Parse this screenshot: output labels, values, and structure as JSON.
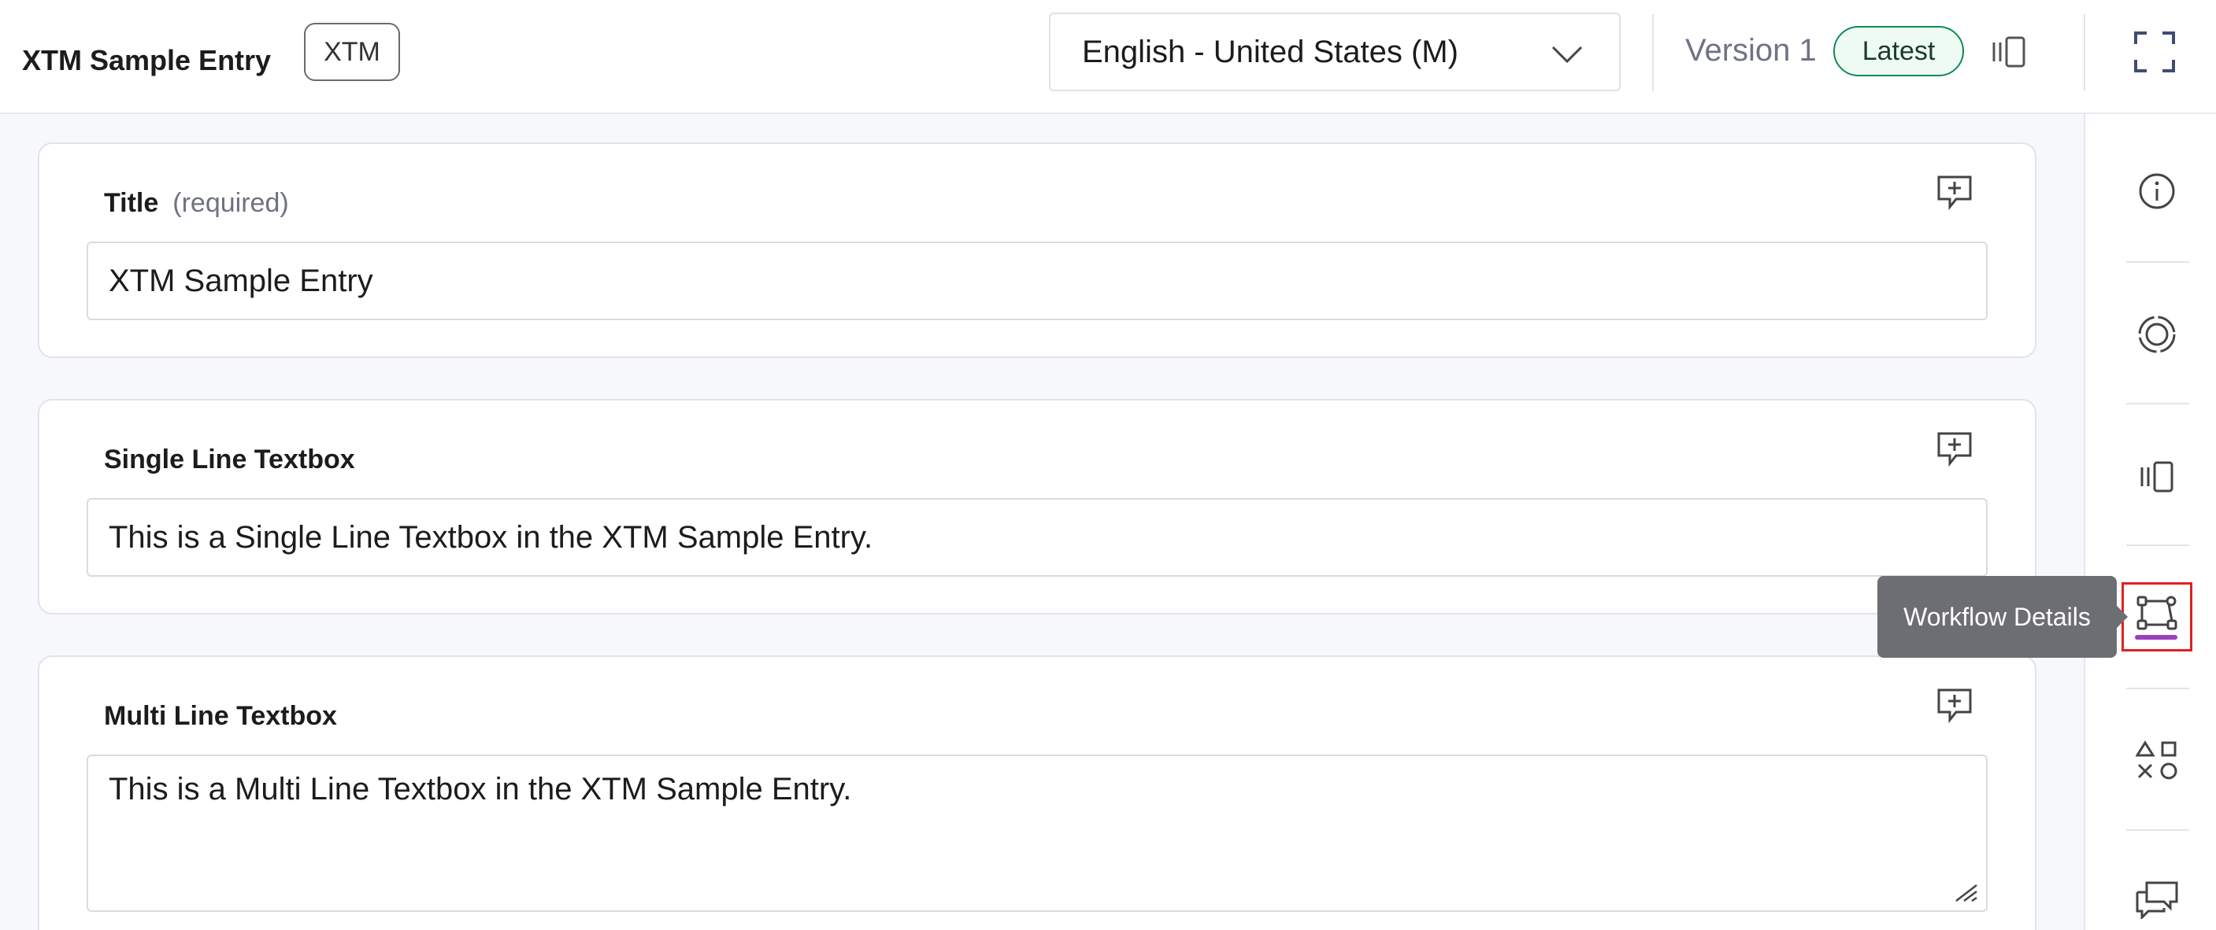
{
  "header": {
    "entry_title": "XTM Sample Entry",
    "tag": "XTM",
    "locale": "English - United States (M)",
    "version_label": "Version 1",
    "version_badge": "Latest"
  },
  "fields": [
    {
      "label": "Title",
      "qualifier": "(required)",
      "value": "XTM Sample Entry"
    },
    {
      "label": "Single Line Textbox",
      "value": "This is a Single Line Textbox in the XTM Sample Entry."
    },
    {
      "label": "Multi Line Textbox",
      "value": "This is a Multi Line Textbox in the XTM Sample Entry."
    }
  ],
  "right_rail": {
    "icons": [
      "info-icon",
      "settings-icon",
      "compare-icon",
      "workflow-icon",
      "content-type-icon",
      "comments-icon"
    ],
    "active": "workflow-icon",
    "tooltip": "Workflow Details"
  },
  "colors": {
    "accent_underline": "#9b3fbf",
    "latest_badge_border": "#0f8a5a",
    "highlight_border": "#e02020"
  }
}
